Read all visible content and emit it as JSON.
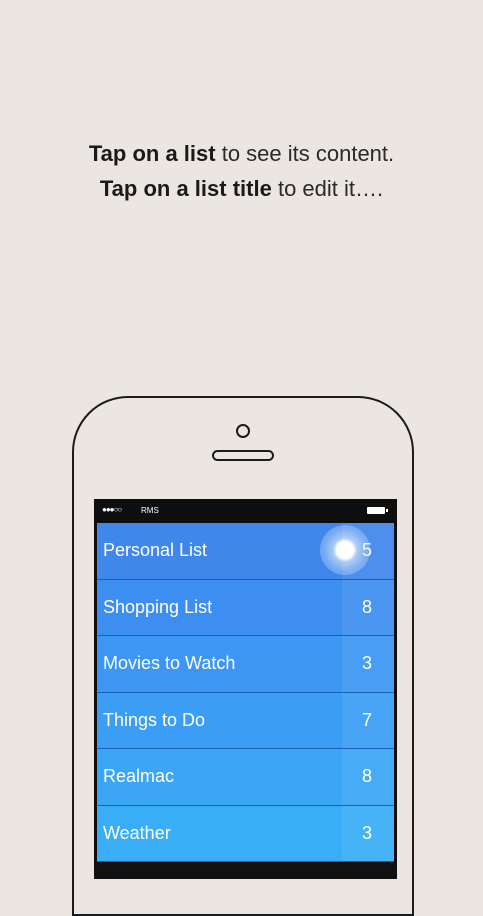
{
  "instructions": {
    "line1_bold": "Tap on a list",
    "line1_rest": "to see its content.",
    "line2_bold": "Tap on a list title",
    "line2_rest": "to edit it…."
  },
  "statusbar": {
    "signal": "●●●○○",
    "carrier": "RMS"
  },
  "lists": [
    {
      "name": "Personal List",
      "count": "5",
      "color": "#3f87eb"
    },
    {
      "name": "Shopping List",
      "count": "8",
      "color": "#3d8ef0"
    },
    {
      "name": "Movies to Watch",
      "count": "3",
      "color": "#3c96f2"
    },
    {
      "name": "Things to Do",
      "count": "7",
      "color": "#3b9ef4"
    },
    {
      "name": "Realmac",
      "count": "8",
      "color": "#3aa6f5"
    },
    {
      "name": "Weather",
      "count": "3",
      "color": "#39aef6"
    }
  ]
}
